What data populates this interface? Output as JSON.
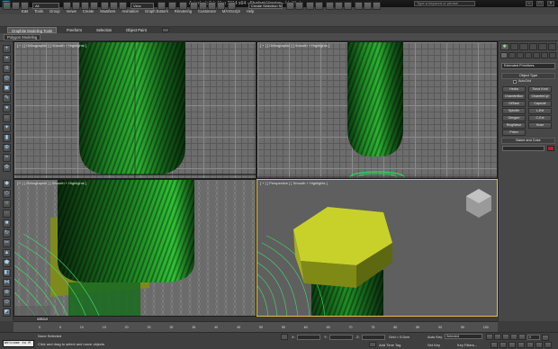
{
  "app": {
    "title": "Autodesk 3ds Max 2014 x64 - Student Version - Untitled",
    "search_placeholder": "Type a keyword or phrase"
  },
  "menu": [
    "Edit",
    "Tools",
    "Group",
    "Views",
    "Create",
    "Modifiers",
    "Animation",
    "Graph Editors",
    "Rendering",
    "Customize",
    "MAXScript",
    "Help"
  ],
  "toolbar": {
    "selection_filter": "All",
    "reference_coord": "View",
    "named_selection": "Create Selection Se"
  },
  "ribbon": {
    "tabs": [
      "Graphite Modeling Tools",
      "Freeform",
      "Selection",
      "Object Paint"
    ],
    "active_tab": "Graphite Modeling Tools",
    "panel_button": "Polygon Modeling"
  },
  "viewports": {
    "top": "[ + ] [ Orthographic ] [ Smooth + Highlights ]",
    "top_right": "[ + ] [ Orthographic ] [ Smooth + Highlights ]",
    "bottom_left": "[ + ] [ Orthographic ] [ Smooth + Highlights ]",
    "perspective": "[ + ] [ Perspective ] [ Smooth + Highlights ]"
  },
  "command_panel": {
    "dropdown": "Extended Primitives",
    "object_type_title": "Object Type",
    "autogrid": "AutoGrid",
    "buttons": [
      "Hedra",
      "Torus Knot",
      "ChamferBox",
      "ChamferCyl",
      "OilTank",
      "Capsule",
      "Spindle",
      "L-Ext",
      "Gengon",
      "C-Ext",
      "RingWave",
      "Hose",
      "Prism"
    ],
    "name_color_title": "Name and Color",
    "object_color": "#c8172f"
  },
  "timeline": {
    "slider": "0 / 100",
    "ticks": [
      "0",
      "5",
      "10",
      "15",
      "20",
      "25",
      "30",
      "35",
      "40",
      "45",
      "50",
      "55",
      "60",
      "65",
      "70",
      "75",
      "80",
      "85",
      "90",
      "95",
      "100"
    ]
  },
  "status": {
    "maxscript": "Welcome to M",
    "selection": "None Selected",
    "prompt": "Click and drag to select and move objects",
    "x_label": "X:",
    "y_label": "Y:",
    "z_label": "Z:",
    "grid": "Grid = 0.0cm",
    "add_time_tag": "Add Time Tag",
    "auto_key": "Auto Key",
    "auto_key_mode": "Selected",
    "set_key": "Set Key",
    "key_filters": "Key Filters...",
    "frame": "0"
  }
}
